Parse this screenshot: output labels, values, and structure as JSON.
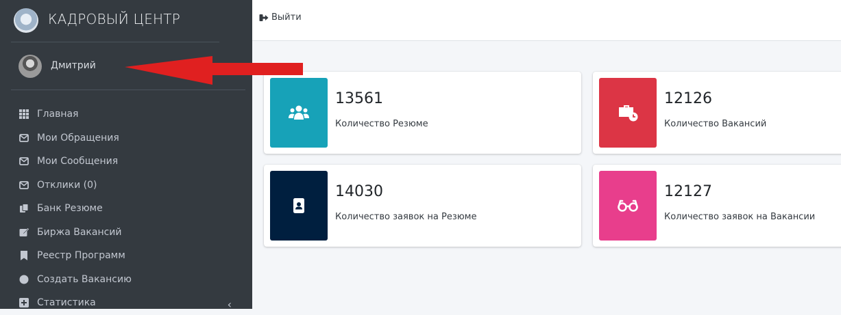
{
  "brand": {
    "title": "КАДРОВЫЙ ЦЕНТР",
    "logo_icon": "emblem-logo"
  },
  "user": {
    "name": "Дмитрий",
    "avatar_icon": "user-avatar"
  },
  "topbar": {
    "logout_label": "Выйти",
    "logout_icon": "sign-out-icon"
  },
  "sidebar": {
    "items": [
      {
        "label": "Главная",
        "icon": "grid-icon"
      },
      {
        "label": "Мои Обращения",
        "icon": "envelope-icon"
      },
      {
        "label": "Мои Сообщения",
        "icon": "envelope-icon"
      },
      {
        "label": "Отклики (0)",
        "icon": "envelope-icon"
      },
      {
        "label": "Банк Резюме",
        "icon": "copy-icon"
      },
      {
        "label": "Биржа Вакансий",
        "icon": "edit-icon"
      },
      {
        "label": "Реестр Программ",
        "icon": "bookmark-icon"
      },
      {
        "label": "Создать Вакансию",
        "icon": "circle-icon"
      },
      {
        "label": "Статистика",
        "icon": "plus-square-icon"
      }
    ]
  },
  "cards": [
    {
      "value": "13561",
      "label": "Количество Резюме",
      "icon": "users-icon",
      "color": "#17a2b8"
    },
    {
      "value": "12126",
      "label": "Количество Вакансий",
      "icon": "briefcase-clock-icon",
      "color": "#dc3545"
    },
    {
      "value": "14030",
      "label": "Количество заявок на Резюме",
      "icon": "id-badge-icon",
      "color": "#001f3f"
    },
    {
      "value": "12127",
      "label": "Количество заявок на Вакансии",
      "icon": "glasses-icon",
      "color": "#e83e8c"
    }
  ],
  "colors": {
    "sidebar_bg": "#343a40",
    "annotation_arrow": "#e02020"
  }
}
